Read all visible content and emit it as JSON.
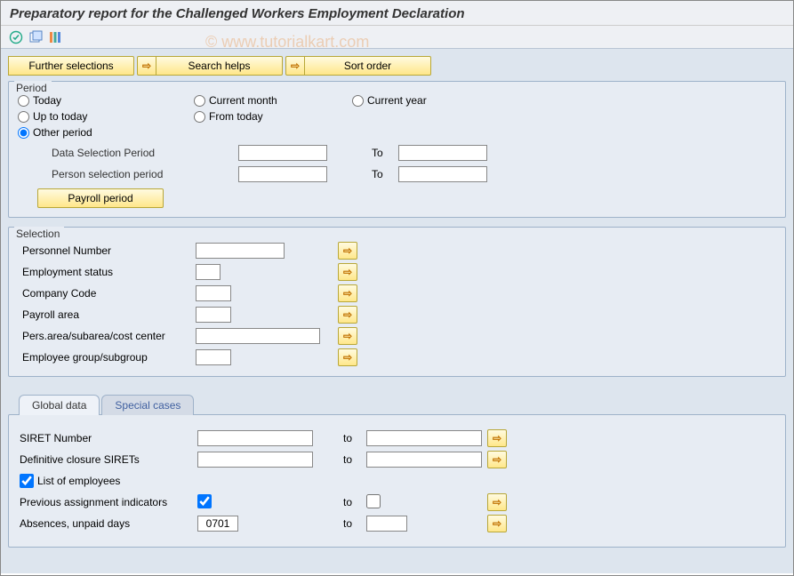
{
  "title": "Preparatory report for the Challenged Workers Employment Declaration",
  "watermark": "© www.tutorialkart.com",
  "toolbar_buttons": {
    "further_selections": "Further selections",
    "search_helps": "Search helps",
    "sort_order": "Sort order"
  },
  "period": {
    "title": "Period",
    "today": "Today",
    "current_month": "Current month",
    "current_year": "Current year",
    "up_to_today": "Up to today",
    "from_today": "From today",
    "other_period": "Other period",
    "data_selection_label": "Data Selection Period",
    "person_selection_label": "Person selection period",
    "to_label": "To",
    "payroll_btn": "Payroll period"
  },
  "selection": {
    "title": "Selection",
    "rows": {
      "personnel_number": "Personnel Number",
      "employment_status": "Employment status",
      "company_code": "Company Code",
      "payroll_area": "Payroll area",
      "pers_area": "Pers.area/subarea/cost center",
      "employee_group": "Employee group/subgroup"
    }
  },
  "tabs": {
    "global_data": "Global data",
    "special_cases": "Special cases"
  },
  "global_data": {
    "siret_number": "SIRET Number",
    "definitive_closure": "Definitive closure SIRETs",
    "list_employees": "List of employees",
    "prev_assignment": "Previous assignment indicators",
    "absences": "Absences, unpaid days",
    "absences_value": "0701",
    "to": "to"
  }
}
